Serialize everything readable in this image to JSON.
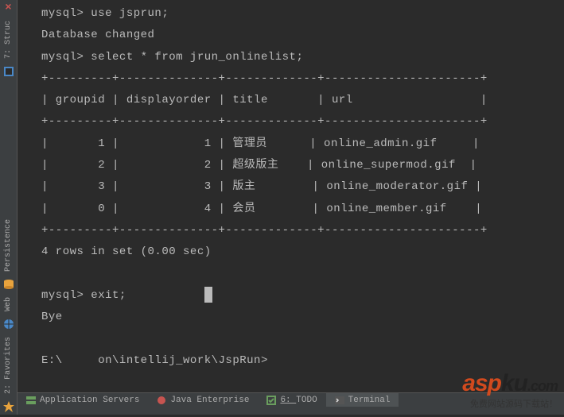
{
  "terminal": {
    "line0": "mysql> use jsprun;",
    "line1": "Database changed",
    "line2": "mysql> select * from jrun_onlinelist;",
    "border": "+---------+--------------+-------------+----------------------+",
    "header": "| groupid | displayorder | title       | url                  |",
    "row1": "|       1 |            1 | 管理员      | online_admin.gif     |",
    "row2": "|       2 |            2 | 超级版主    | online_supermod.gif  |",
    "row3": "|       3 |            3 | 版主        | online_moderator.gif |",
    "row4": "|       0 |            4 | 会员        | online_member.gif    |",
    "summary": "4 rows in set (0.00 sec)",
    "exit": "mysql> exit;",
    "bye": "Bye",
    "prompt": "E:\\     on\\intellij_work\\JspRun>"
  },
  "left_tabs": {
    "structure": "7: Struc",
    "persistence": "Persistence",
    "web": "Web",
    "favorites": "2: Favorites"
  },
  "bottom_tabs": {
    "app_servers": "Application Servers",
    "java_ee": "Java Enterprise",
    "todo_prefix": "6: ",
    "todo": "TODO",
    "terminal": "Terminal"
  },
  "watermark": {
    "brand_a": "asp",
    "brand_b": "ku",
    "brand_c": ".com",
    "sub": "免费网站源码下载站！"
  }
}
